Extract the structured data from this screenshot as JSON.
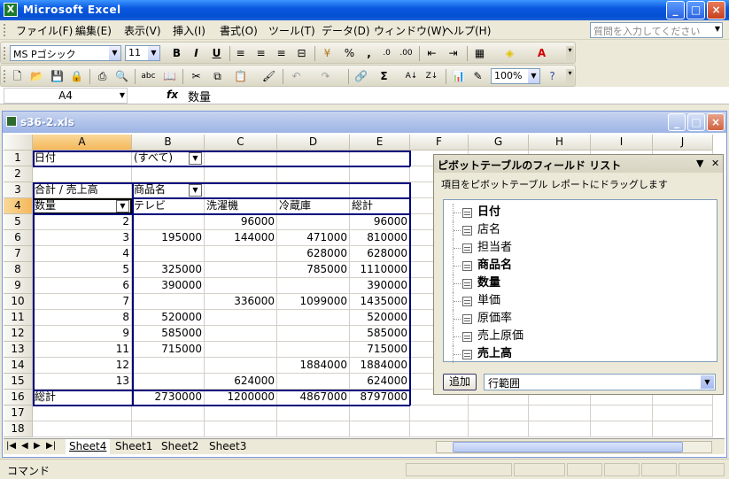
{
  "app": {
    "title": "Microsoft Excel",
    "logo": "X",
    "minimize": "_",
    "maximize": "□",
    "close": "×"
  },
  "menu": [
    "ファイル(F)",
    "編集(E)",
    "表示(V)",
    "挿入(I)",
    "書式(O)",
    "ツール(T)",
    "データ(D)",
    "ウィンドウ(W)",
    "ヘルプ(H)"
  ],
  "help_placeholder": "質問を入力してください",
  "format_toolbar": {
    "font": "MS Pゴシック",
    "size": "11",
    "bold": "B",
    "italic": "I",
    "underline": "U",
    "percent": "%",
    "comma": ","
  },
  "std_toolbar": {
    "zoom": "100%",
    "sigma": "Σ"
  },
  "formula": {
    "name_box": "A4",
    "fx": "fx",
    "value": "数量"
  },
  "workbook": {
    "title": "s36-2.xls"
  },
  "columns": [
    "A",
    "B",
    "C",
    "D",
    "E",
    "F",
    "G",
    "H",
    "I",
    "J"
  ],
  "rows": [
    "1",
    "2",
    "3",
    "4",
    "5",
    "6",
    "7",
    "8",
    "9",
    "10",
    "11",
    "12",
    "13",
    "14",
    "15",
    "16",
    "17",
    "18"
  ],
  "cells": {
    "r1": {
      "A": "日付",
      "B": "(すべて)"
    },
    "r3": {
      "A": "合計 / 売上高",
      "B": "商品名"
    },
    "r4": {
      "A": "数量",
      "B": "テレビ",
      "C": "洗濯機",
      "D": "冷蔵庫",
      "E": "総計"
    },
    "data": [
      [
        "2",
        "",
        "96000",
        "",
        "96000"
      ],
      [
        "3",
        "195000",
        "144000",
        "471000",
        "810000"
      ],
      [
        "4",
        "",
        "",
        "628000",
        "628000"
      ],
      [
        "5",
        "325000",
        "",
        "785000",
        "1110000"
      ],
      [
        "6",
        "390000",
        "",
        "",
        "390000"
      ],
      [
        "7",
        "",
        "336000",
        "1099000",
        "1435000"
      ],
      [
        "8",
        "520000",
        "",
        "",
        "520000"
      ],
      [
        "9",
        "585000",
        "",
        "",
        "585000"
      ],
      [
        "11",
        "715000",
        "",
        "",
        "715000"
      ],
      [
        "12",
        "",
        "",
        "1884000",
        "1884000"
      ],
      [
        "13",
        "",
        "624000",
        "",
        "624000"
      ]
    ],
    "r16": {
      "A": "総計",
      "B": "2730000",
      "C": "1200000",
      "D": "4867000",
      "E": "8797000"
    }
  },
  "sheets": [
    "Sheet4",
    "Sheet1",
    "Sheet2",
    "Sheet3"
  ],
  "status": "コマンド",
  "pivot_pane": {
    "title": "ピボットテーブルのフィールド リスト",
    "description": "項目をピボットテーブル レポートにドラッグします",
    "fields": [
      {
        "label": "日付",
        "bold": true
      },
      {
        "label": "店名",
        "bold": false
      },
      {
        "label": "担当者",
        "bold": false
      },
      {
        "label": "商品名",
        "bold": true
      },
      {
        "label": "数量",
        "bold": true
      },
      {
        "label": "単価",
        "bold": false
      },
      {
        "label": "原価率",
        "bold": false
      },
      {
        "label": "売上原価",
        "bold": false
      },
      {
        "label": "売上高",
        "bold": true
      }
    ],
    "add_button": "追加",
    "area": "行範囲"
  }
}
